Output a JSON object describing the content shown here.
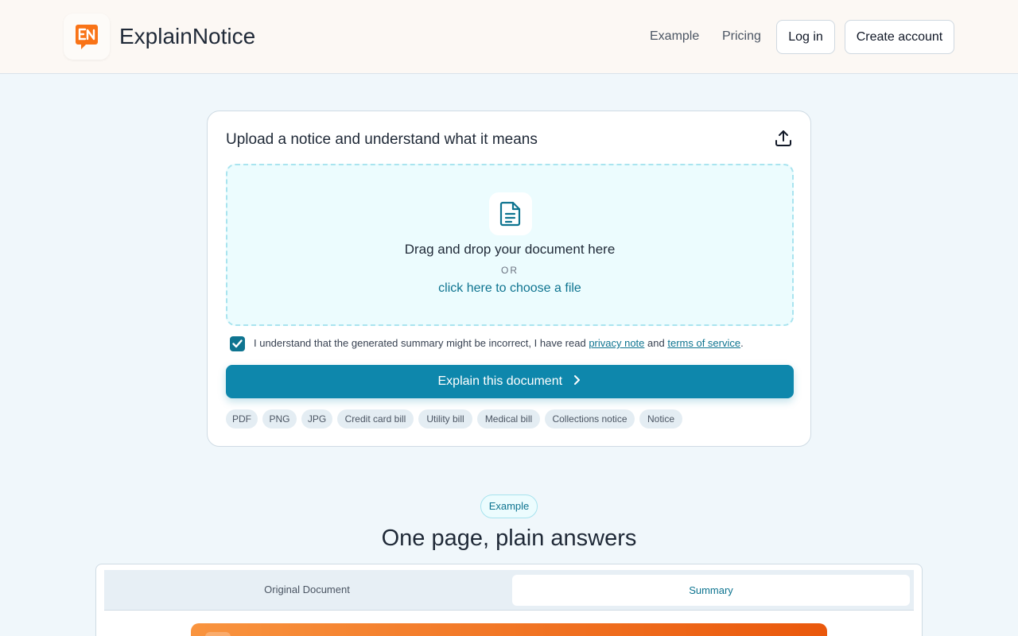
{
  "header": {
    "brand": "ExplainNotice",
    "logo_text": "EN",
    "nav": [
      "Example",
      "Pricing"
    ],
    "login_label": "Log in",
    "create_account_label": "Create account"
  },
  "upload": {
    "title": "Upload a notice and understand what it means",
    "drop_main": "Drag and drop your document here",
    "drop_or": "OR",
    "drop_link": "click here to choose a file",
    "consent_prefix": "I understand that the generated summary might be incorrect, I have read",
    "consent_privacy": "privacy note",
    "consent_and": "and",
    "consent_terms": "terms of service",
    "consent_suffix": ".",
    "consent_checked": true,
    "primary_label": "Explain this document",
    "chips": [
      "PDF",
      "PNG",
      "JPG",
      "Credit card bill",
      "Utility bill",
      "Medical bill",
      "Collections notice",
      "Notice"
    ]
  },
  "example": {
    "pill": "Example",
    "title": "One page, plain answers",
    "tabs": [
      "Original Document",
      "Summary"
    ],
    "active_tab": "Summary"
  },
  "colors": {
    "accent": "#0e87ac",
    "accent_text": "#0e7490",
    "brand_orange": "#ea580c",
    "background": "#f0f7fb"
  },
  "icons": {
    "logo": "en-logo-icon",
    "upload": "upload-icon",
    "document": "document-icon",
    "check": "check-icon",
    "chevron": "chevron-right-icon"
  }
}
